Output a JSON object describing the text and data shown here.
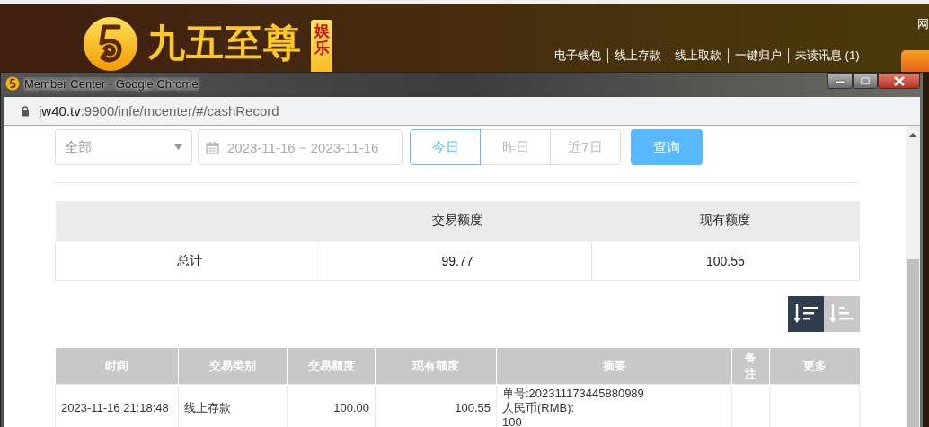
{
  "site_header": {
    "logo_text": "九五至尊",
    "logo_badge": "娱乐",
    "nav_links": [
      "电子钱包",
      "线上存款",
      "线上取款",
      "一键归户",
      "未读讯息 (1)"
    ],
    "edge_text": "网"
  },
  "window": {
    "title": "Member Center - Google Chrome",
    "url_host": "jw40.tv",
    "url_path": ":9900/infe/mcenter/#/cashRecord"
  },
  "filters": {
    "type_select": "全部",
    "date_range": "2023-11-16 ~ 2023-11-16",
    "ranges": [
      {
        "label": "今日",
        "selected": true
      },
      {
        "label": "昨日",
        "selected": false
      },
      {
        "label": "近7日",
        "selected": false
      }
    ],
    "query_button": "查询"
  },
  "summary": {
    "columns": [
      "交易额度",
      "现有额度"
    ],
    "rows": [
      {
        "label": "总计",
        "values": [
          "99.77",
          "100.55"
        ]
      }
    ]
  },
  "sort_buttons": [
    {
      "kind": "descending",
      "selected": true
    },
    {
      "kind": "ascending",
      "selected": false
    }
  ],
  "table": {
    "columns": [
      "时间",
      "交易类别",
      "交易额度",
      "现有额度",
      "摘要",
      "备注",
      "更多"
    ],
    "rows": [
      {
        "time": "2023-11-16 21:18:48",
        "type": "线上存款",
        "amount": "100.00",
        "balance": "100.55",
        "summary": [
          "单号:202311173445880989",
          "人民币(RMB):",
          "100"
        ]
      }
    ]
  }
}
